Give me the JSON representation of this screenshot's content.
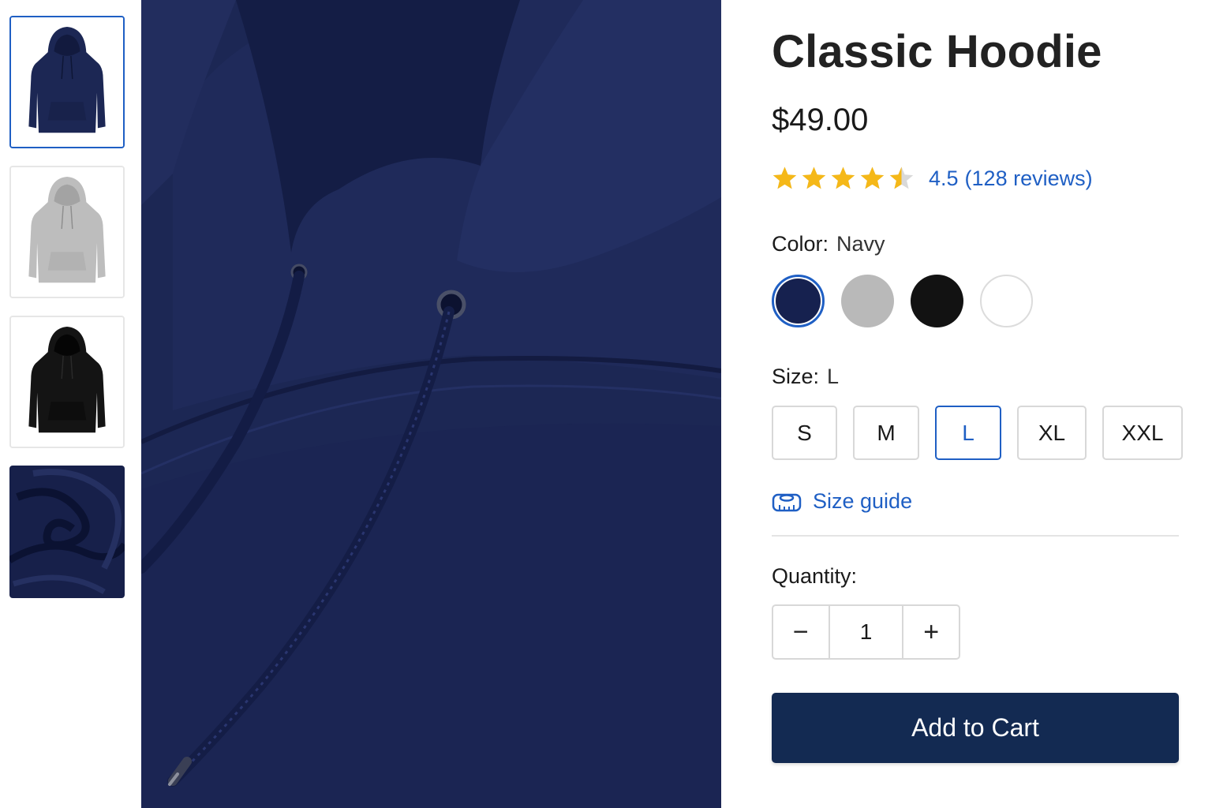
{
  "product": {
    "title": "Classic Hoodie",
    "price": "$49.00",
    "rating": {
      "value": "4.5",
      "reviews": "(128 reviews)",
      "stars_filled": 4.5,
      "stars_total": 5,
      "star_color": "#f5b818"
    }
  },
  "thumbnails": [
    {
      "name": "thumbnail-navy-hoodie",
      "selected": true
    },
    {
      "name": "thumbnail-gray-hoodie",
      "selected": false
    },
    {
      "name": "thumbnail-black-hoodie",
      "selected": false
    },
    {
      "name": "thumbnail-fabric-closeup",
      "selected": false
    }
  ],
  "color": {
    "label": "Color:",
    "selected": "Navy",
    "swatches": [
      {
        "color": "#16214f",
        "selected": true
      },
      {
        "color": "#b9b9b9",
        "selected": false
      },
      {
        "color": "#121212",
        "selected": false
      },
      {
        "color": "#ffffff",
        "selected": false
      }
    ]
  },
  "size": {
    "label": "Size:",
    "selected": "L",
    "options": [
      "S",
      "M",
      "L",
      "XL",
      "XXL"
    ]
  },
  "size_guide": {
    "label": "Size guide",
    "icon": "measuring-tape-icon"
  },
  "quantity": {
    "label": "Quantity:",
    "value": "1",
    "minus": "−",
    "plus": "+"
  },
  "cart": {
    "label": "Add to Cart"
  },
  "colors": {
    "accent": "#1f5fc4",
    "button": "#132a52"
  }
}
